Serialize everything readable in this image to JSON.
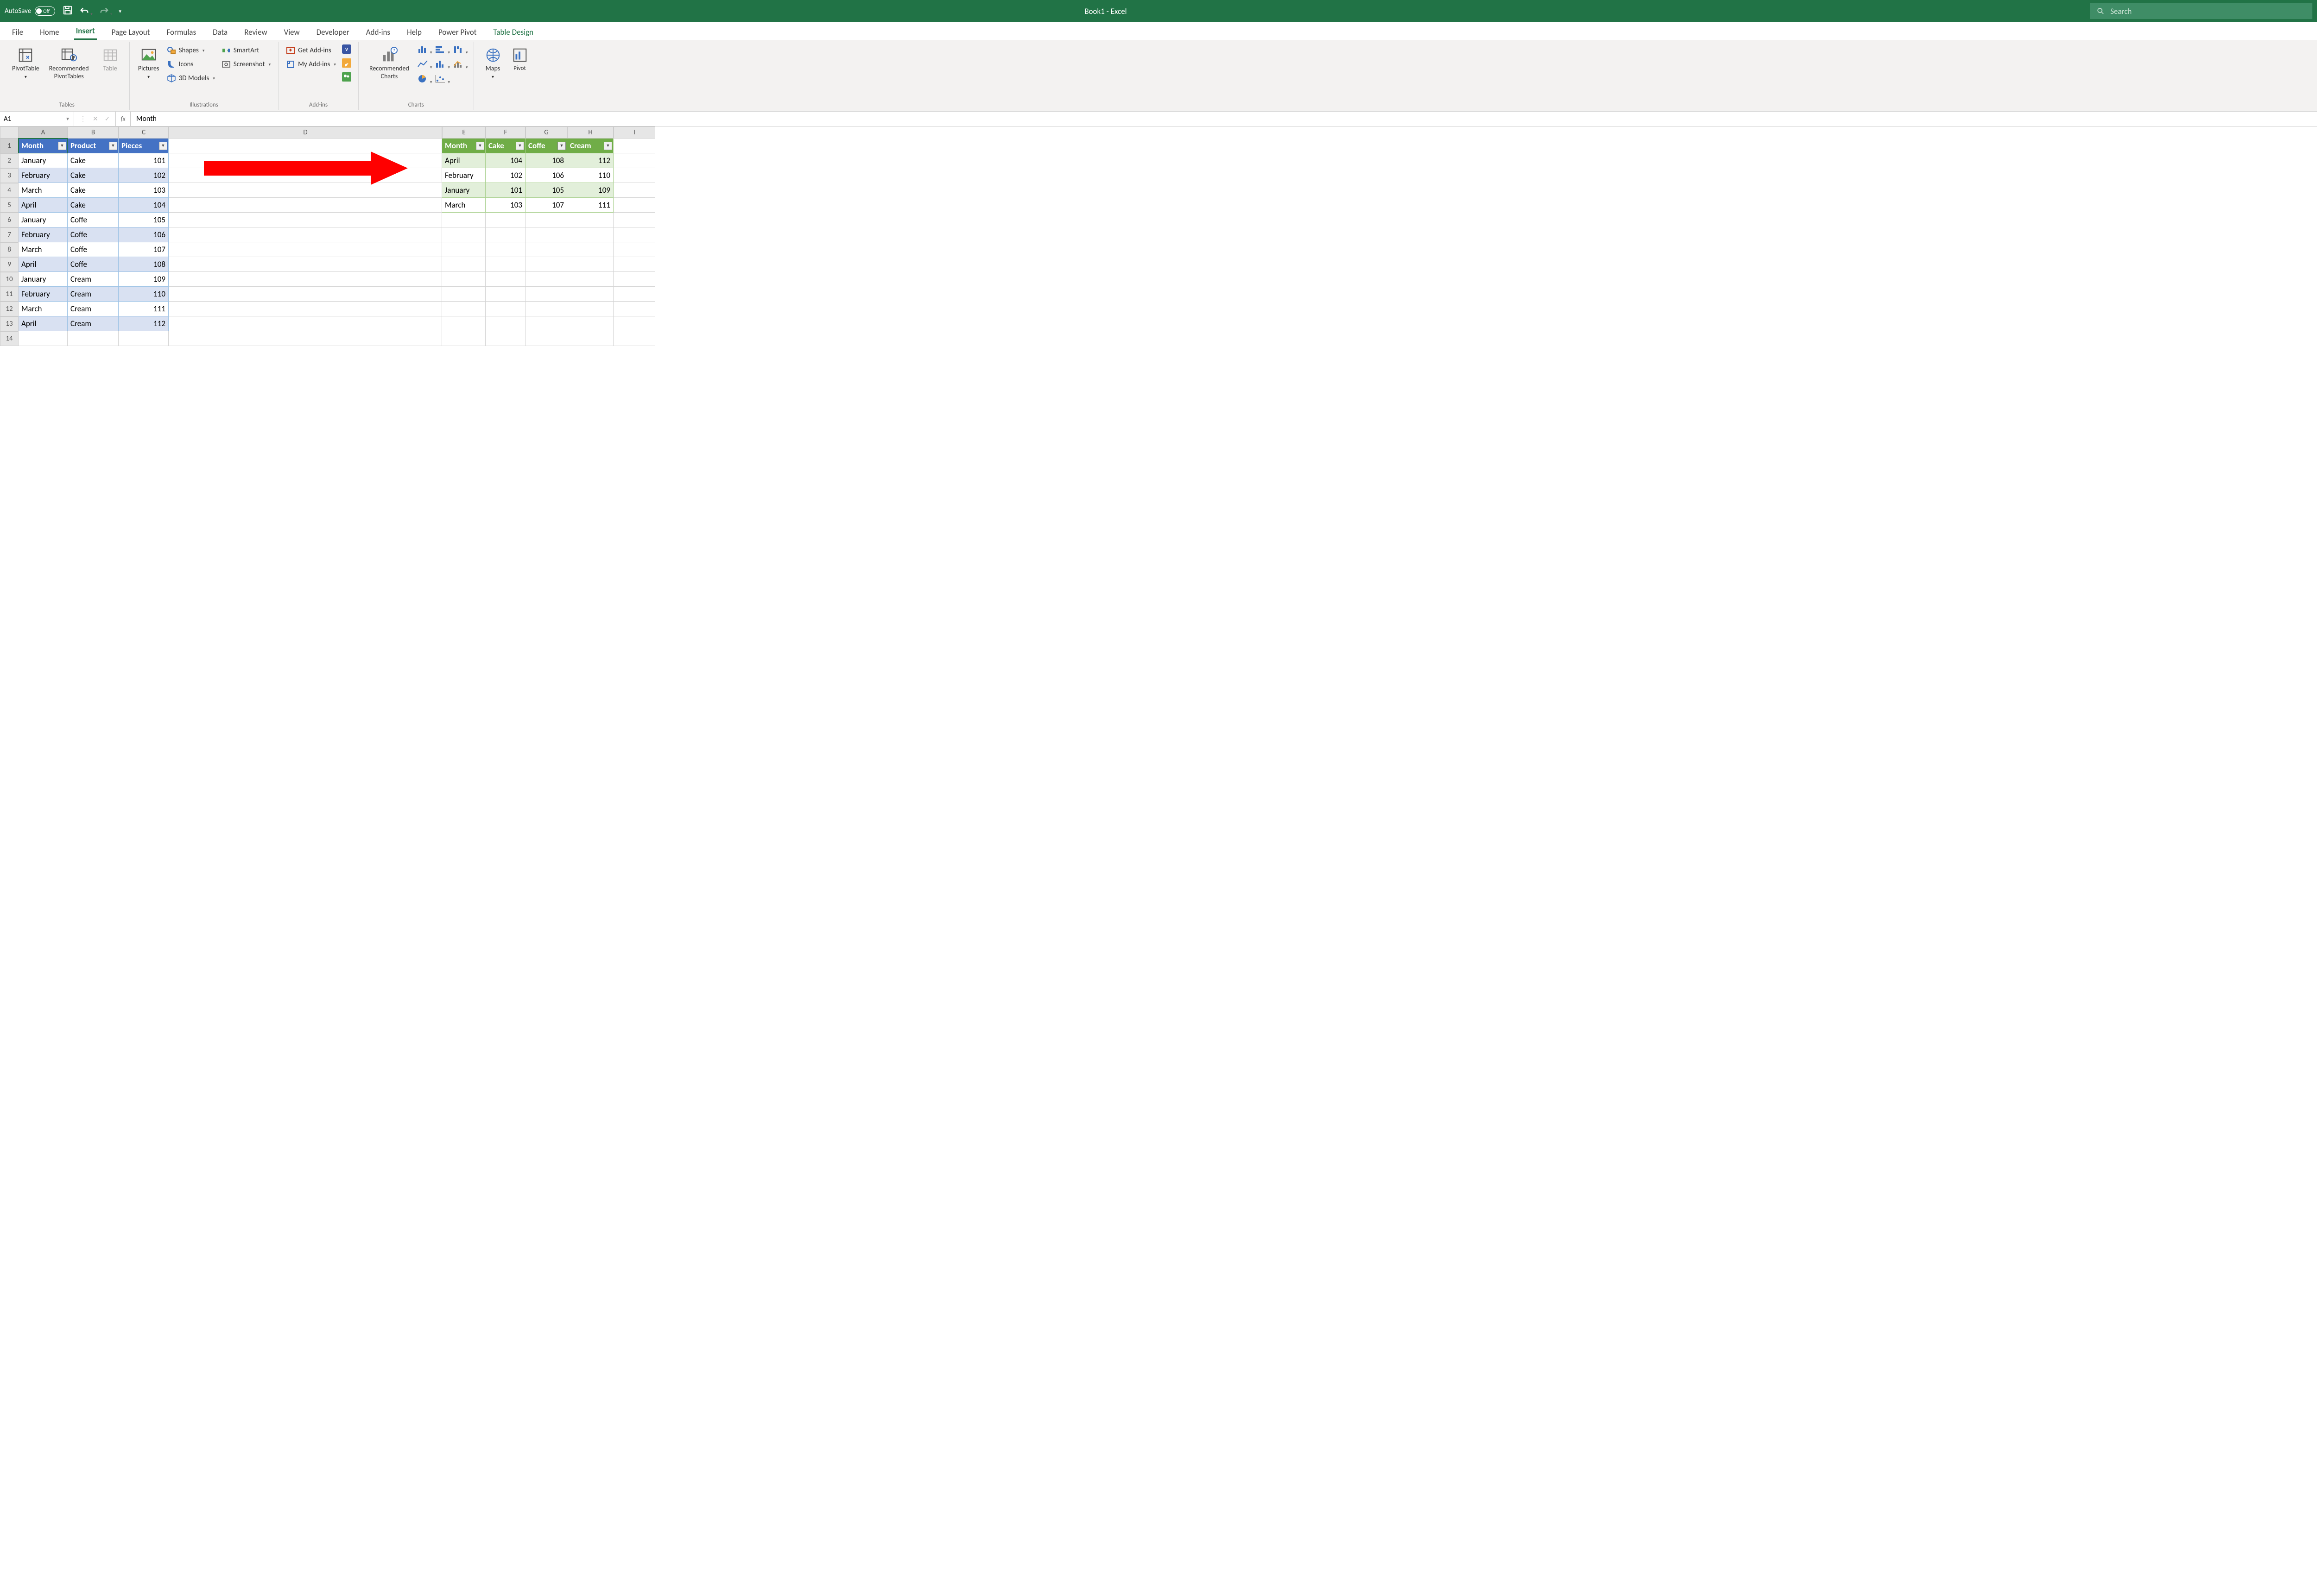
{
  "titlebar": {
    "autosave_label": "AutoSave",
    "autosave_state": "Off",
    "title": "Book1  -  Excel",
    "search_placeholder": "Search"
  },
  "tabs": [
    "File",
    "Home",
    "Insert",
    "Page Layout",
    "Formulas",
    "Data",
    "Review",
    "View",
    "Developer",
    "Add-ins",
    "Help",
    "Power Pivot",
    "Table Design"
  ],
  "active_tab": "Insert",
  "ribbon": {
    "tables": {
      "label": "Tables",
      "pivot": "PivotTable",
      "rec": "Recommended PivotTables",
      "table": "Table"
    },
    "illus": {
      "label": "Illustrations",
      "pictures": "Pictures",
      "shapes": "Shapes",
      "icons": "Icons",
      "models": "3D Models",
      "smartart": "SmartArt",
      "screenshot": "Screenshot"
    },
    "addins": {
      "label": "Add-ins",
      "get": "Get Add-ins",
      "my": "My Add-ins"
    },
    "charts": {
      "label": "Charts",
      "rec": "Recommended Charts",
      "maps": "Maps",
      "pivot": "PivotChart"
    }
  },
  "namebox": "A1",
  "fx_label": "fx",
  "formula": "Month",
  "cols": [
    "A",
    "B",
    "C",
    "D",
    "E",
    "F",
    "G",
    "H",
    "I"
  ],
  "rownums": [
    1,
    2,
    3,
    4,
    5,
    6,
    7,
    8,
    9,
    10,
    11,
    12,
    13,
    14
  ],
  "table1": {
    "headers": [
      "Month",
      "Product",
      "Pieces"
    ],
    "rows": [
      [
        "January",
        "Cake",
        "101"
      ],
      [
        "February",
        "Cake",
        "102"
      ],
      [
        "March",
        "Cake",
        "103"
      ],
      [
        "April",
        "Cake",
        "104"
      ],
      [
        "January",
        "Coffe",
        "105"
      ],
      [
        "February",
        "Coffe",
        "106"
      ],
      [
        "March",
        "Coffe",
        "107"
      ],
      [
        "April",
        "Coffe",
        "108"
      ],
      [
        "January",
        "Cream",
        "109"
      ],
      [
        "February",
        "Cream",
        "110"
      ],
      [
        "March",
        "Cream",
        "111"
      ],
      [
        "April",
        "Cream",
        "112"
      ]
    ]
  },
  "table2": {
    "headers": [
      "Month",
      "Cake",
      "Coffe",
      "Cream"
    ],
    "rows": [
      [
        "April",
        "104",
        "108",
        "112"
      ],
      [
        "February",
        "102",
        "106",
        "110"
      ],
      [
        "January",
        "101",
        "105",
        "109"
      ],
      [
        "March",
        "103",
        "107",
        "111"
      ]
    ]
  },
  "colors": {
    "excel_green": "#217346",
    "arrow": "#ff0000"
  }
}
